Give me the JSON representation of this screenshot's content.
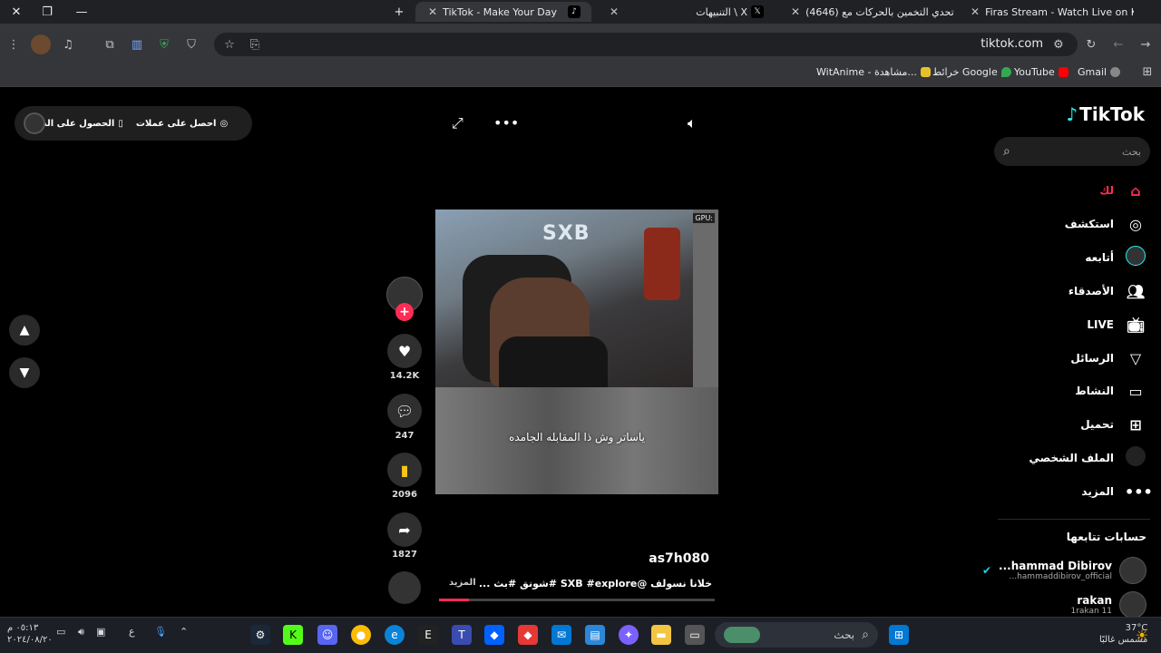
{
  "browser": {
    "tabs": [
      {
        "title": "Firas Stream - Watch Live on Ki",
        "active": false
      },
      {
        "title": "(4646) تحدي التخمين بالحركات مع",
        "active": false
      },
      {
        "title": "التنبيهات \\ X",
        "active": false
      },
      {
        "title": "TikTok - Make Your Day",
        "active": true
      }
    ],
    "url": "tiktok.com",
    "bookmarks": [
      {
        "label": "Gmail"
      },
      {
        "label": "YouTube"
      },
      {
        "label": "خرائط Google"
      },
      {
        "label": "WitAnime - مشاهدة..."
      }
    ]
  },
  "tiktok": {
    "logo_text": "TikTok",
    "search_placeholder": "بحث",
    "nav": [
      {
        "label": "لك",
        "icon": "home-icon",
        "active": true
      },
      {
        "label": "استكشف",
        "icon": "compass-icon"
      },
      {
        "label": "أتابعه",
        "icon": "following-avatar-icon"
      },
      {
        "label": "الأصدقاء",
        "icon": "friends-icon"
      },
      {
        "label": "LIVE",
        "icon": "live-tv-icon"
      },
      {
        "label": "الرسائل",
        "icon": "send-icon"
      },
      {
        "label": "النشاط",
        "icon": "inbox-icon"
      },
      {
        "label": "تحميل",
        "icon": "upload-icon"
      },
      {
        "label": "الملف الشخصي",
        "icon": "profile-avatar-icon"
      },
      {
        "label": "المزيد",
        "icon": "more-dots-icon"
      }
    ],
    "following_header": "حسابات تتابعها",
    "following": [
      {
        "name": "...hammad Dibirov",
        "handle": "...hammaddibirov_official",
        "verified": true
      },
      {
        "name": "rakan",
        "handle": "1rakan 11",
        "verified": false
      }
    ],
    "promo": {
      "get_coins": "احصل على عملات",
      "get_app": "الحصول على الت..."
    },
    "video": {
      "gpu_label": "GPU:",
      "logo": "SXB",
      "subtitle": "ياساتر وش ذا المقابله الجامده",
      "username": "as7h080",
      "caption": "خلانا نسولف @SXB #explore #شونق #بث ...",
      "more_label": "المزيد",
      "progress": 0.11
    },
    "actions": {
      "likes": "14.2K",
      "comments": "247",
      "saves": "2096",
      "shares": "1827"
    }
  },
  "taskbar": {
    "search_placeholder": "بحث",
    "weather_temp": "37°C",
    "weather_text": "مشمس غالبًا",
    "time": "٠٥:١٣ م",
    "date": "٢٠٢٤/٠٨/٢٠",
    "lang": "ع"
  }
}
